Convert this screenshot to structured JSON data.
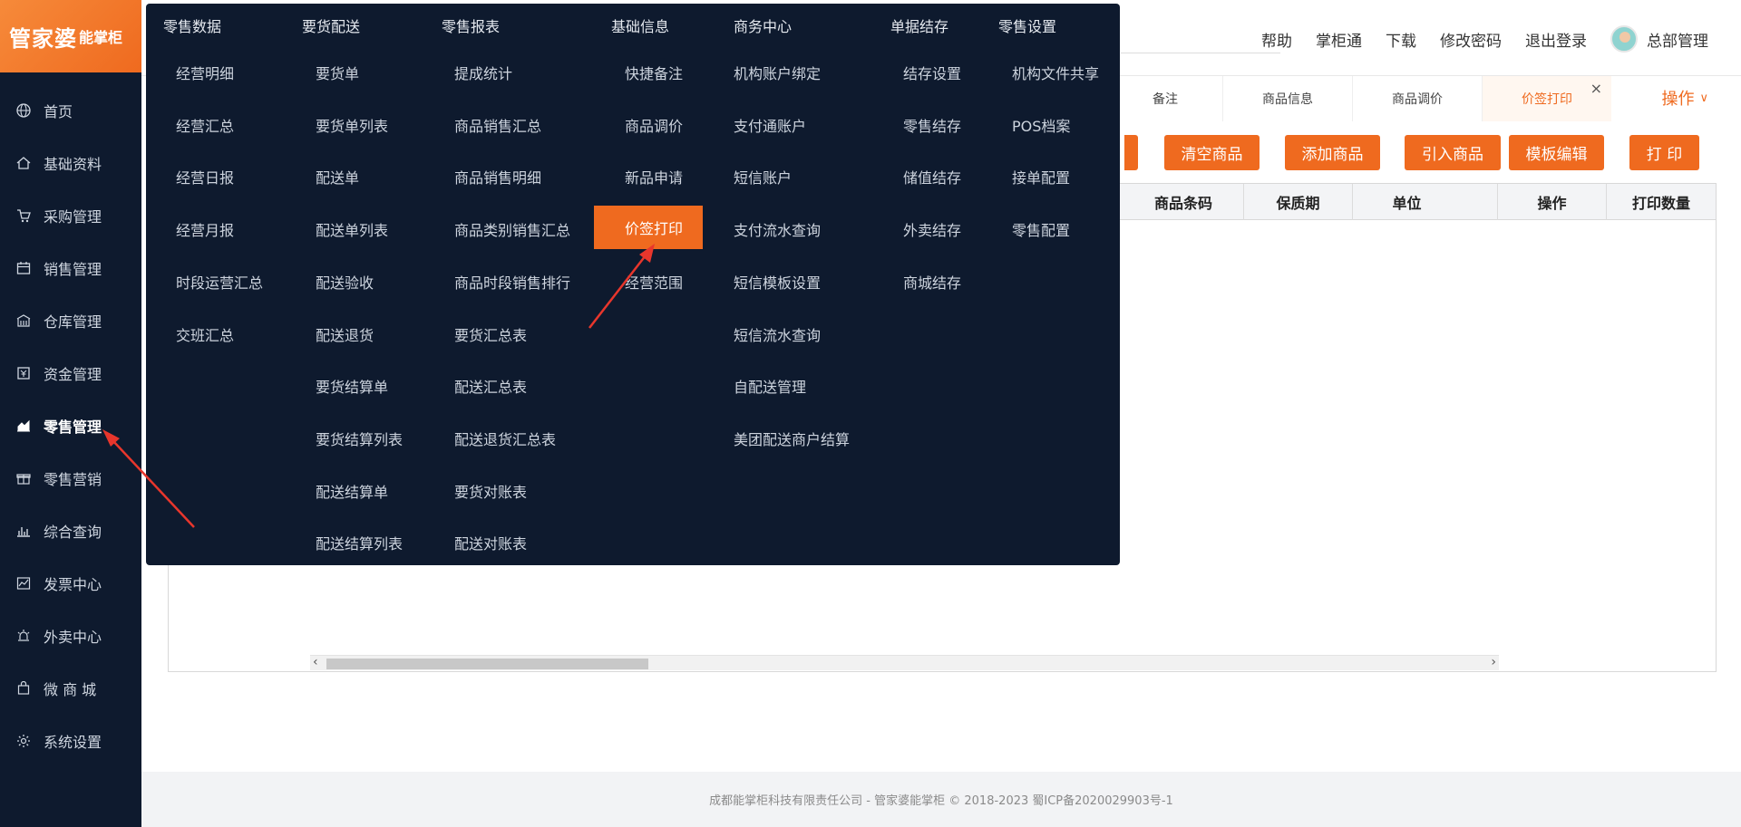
{
  "logo": {
    "brand": "管家婆",
    "sub": "能掌柜"
  },
  "sidebar": {
    "items": [
      {
        "label": "首页",
        "icon": "globe-icon"
      },
      {
        "label": "基础资料",
        "icon": "home-icon"
      },
      {
        "label": "采购管理",
        "icon": "cart-icon"
      },
      {
        "label": "销售管理",
        "icon": "calendar-icon"
      },
      {
        "label": "仓库管理",
        "icon": "warehouse-icon"
      },
      {
        "label": "资金管理",
        "icon": "fund-icon"
      },
      {
        "label": "零售管理",
        "icon": "chart-icon"
      },
      {
        "label": "零售营销",
        "icon": "gift-icon"
      },
      {
        "label": "综合查询",
        "icon": "bar-chart-icon"
      },
      {
        "label": "发票中心",
        "icon": "line-chart-icon"
      },
      {
        "label": "外卖中心",
        "icon": "alarm-icon"
      },
      {
        "label": "微 商 城",
        "icon": "bag-icon"
      },
      {
        "label": "系统设置",
        "icon": "gear-icon"
      }
    ]
  },
  "topbar": {
    "links": [
      "帮助",
      "掌柜通",
      "下载",
      "修改密码",
      "退出登录"
    ],
    "user": "总部管理"
  },
  "tabs": [
    {
      "label": "备注"
    },
    {
      "label": "商品信息"
    },
    {
      "label": "商品调价"
    },
    {
      "label": "价签打印"
    }
  ],
  "operations": "操作",
  "toolbar": [
    "清空商品",
    "添加商品",
    "引入商品",
    "模板编辑",
    "打 印"
  ],
  "table": {
    "headers": [
      "商品条码",
      "保质期",
      "单位",
      "操作",
      "打印数量"
    ]
  },
  "megamenu": {
    "columns": [
      {
        "title": "零售数据",
        "items": [
          "经营明细",
          "经营汇总",
          "经营日报",
          "经营月报",
          "时段运营汇总",
          "交班汇总"
        ]
      },
      {
        "title": "要货配送",
        "items": [
          "要货单",
          "要货单列表",
          "配送单",
          "配送单列表",
          "配送验收",
          "配送退货",
          "要货结算单",
          "要货结算列表",
          "配送结算单",
          "配送结算列表"
        ]
      },
      {
        "title": "零售报表",
        "items": [
          "提成统计",
          "商品销售汇总",
          "商品销售明细",
          "商品类别销售汇总",
          "商品时段销售排行",
          "要货汇总表",
          "配送汇总表",
          "配送退货汇总表",
          "要货对账表",
          "配送对账表"
        ]
      },
      {
        "title": "基础信息",
        "items": [
          "快捷备注",
          "商品调价",
          "新品申请",
          "价签打印",
          "经营范围"
        ]
      },
      {
        "title": "商务中心",
        "items": [
          "机构账户绑定",
          "支付通账户",
          "短信账户",
          "支付流水查询",
          "短信模板设置",
          "短信流水查询",
          "自配送管理",
          "美团配送商户结算"
        ]
      },
      {
        "title": "单据结存",
        "items": [
          "结存设置",
          "零售结存",
          "储值结存",
          "外卖结存",
          "商城结存"
        ]
      },
      {
        "title": "零售设置",
        "items": [
          "机构文件共享",
          "POS档案",
          "接单配置",
          "零售配置"
        ]
      }
    ]
  },
  "footer": "成都能掌柜科技有限责任公司 - 管家婆能掌柜 © 2018-2023 蜀ICP备2020029903号-1",
  "colors": {
    "accent": "#ef6a1f",
    "sidebar": "#0e1a2e",
    "annotation": "#e8362c"
  }
}
